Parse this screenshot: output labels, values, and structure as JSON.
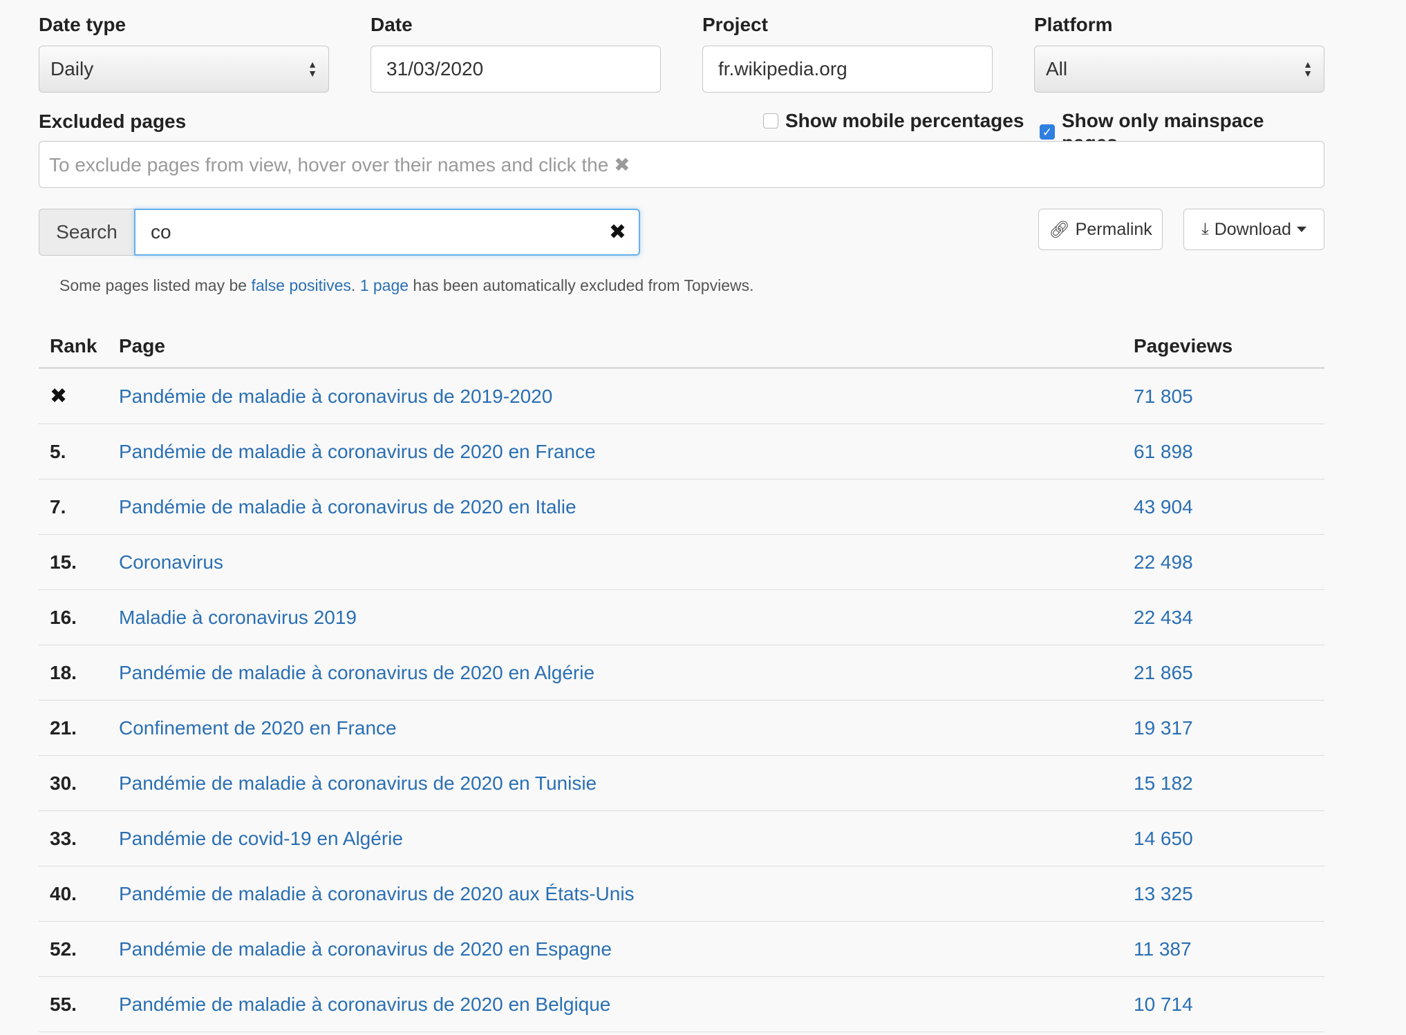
{
  "controls": {
    "date_type": {
      "label": "Date type",
      "value": "Daily"
    },
    "date": {
      "label": "Date",
      "value": "31/03/2020"
    },
    "project": {
      "label": "Project",
      "value": "fr.wikipedia.org"
    },
    "platform": {
      "label": "Platform",
      "value": "All"
    }
  },
  "excluded": {
    "label": "Excluded pages",
    "placeholder": "To exclude pages from view, hover over their names and click the ✖",
    "mobile_pct_label": "Show mobile percentages",
    "mobile_pct_checked": false,
    "mainspace_label": "Show only mainspace pages",
    "mainspace_checked": true
  },
  "search": {
    "addon_label": "Search",
    "value": "co",
    "clear_icon": "✖"
  },
  "buttons": {
    "permalink": "Permalink",
    "download": "Download"
  },
  "notice": {
    "prefix": "Some pages listed may be ",
    "link1": "false positives",
    "middle": ". ",
    "link2": "1 page",
    "suffix": " has been automatically excluded from Topviews."
  },
  "table": {
    "headers": {
      "rank": "Rank",
      "page": "Page",
      "pageviews": "Pageviews"
    },
    "rows": [
      {
        "rank": "✖",
        "page": "Pandémie de maladie à coronavirus de 2019-2020",
        "views": "71 805"
      },
      {
        "rank": "5.",
        "page": "Pandémie de maladie à coronavirus de 2020 en France",
        "views": "61 898"
      },
      {
        "rank": "7.",
        "page": "Pandémie de maladie à coronavirus de 2020 en Italie",
        "views": "43 904"
      },
      {
        "rank": "15.",
        "page": "Coronavirus",
        "views": "22 498"
      },
      {
        "rank": "16.",
        "page": "Maladie à coronavirus 2019",
        "views": "22 434"
      },
      {
        "rank": "18.",
        "page": "Pandémie de maladie à coronavirus de 2020 en Algérie",
        "views": "21 865"
      },
      {
        "rank": "21.",
        "page": "Confinement de 2020 en France",
        "views": "19 317"
      },
      {
        "rank": "30.",
        "page": "Pandémie de maladie à coronavirus de 2020 en Tunisie",
        "views": "15 182"
      },
      {
        "rank": "33.",
        "page": "Pandémie de covid-19 en Algérie",
        "views": "14 650"
      },
      {
        "rank": "40.",
        "page": "Pandémie de maladie à coronavirus de 2020 aux États-Unis",
        "views": "13 325"
      },
      {
        "rank": "52.",
        "page": "Pandémie de maladie à coronavirus de 2020 en Espagne",
        "views": "11 387"
      },
      {
        "rank": "55.",
        "page": "Pandémie de maladie à coronavirus de 2020 en Belgique",
        "views": "10 714"
      }
    ]
  }
}
